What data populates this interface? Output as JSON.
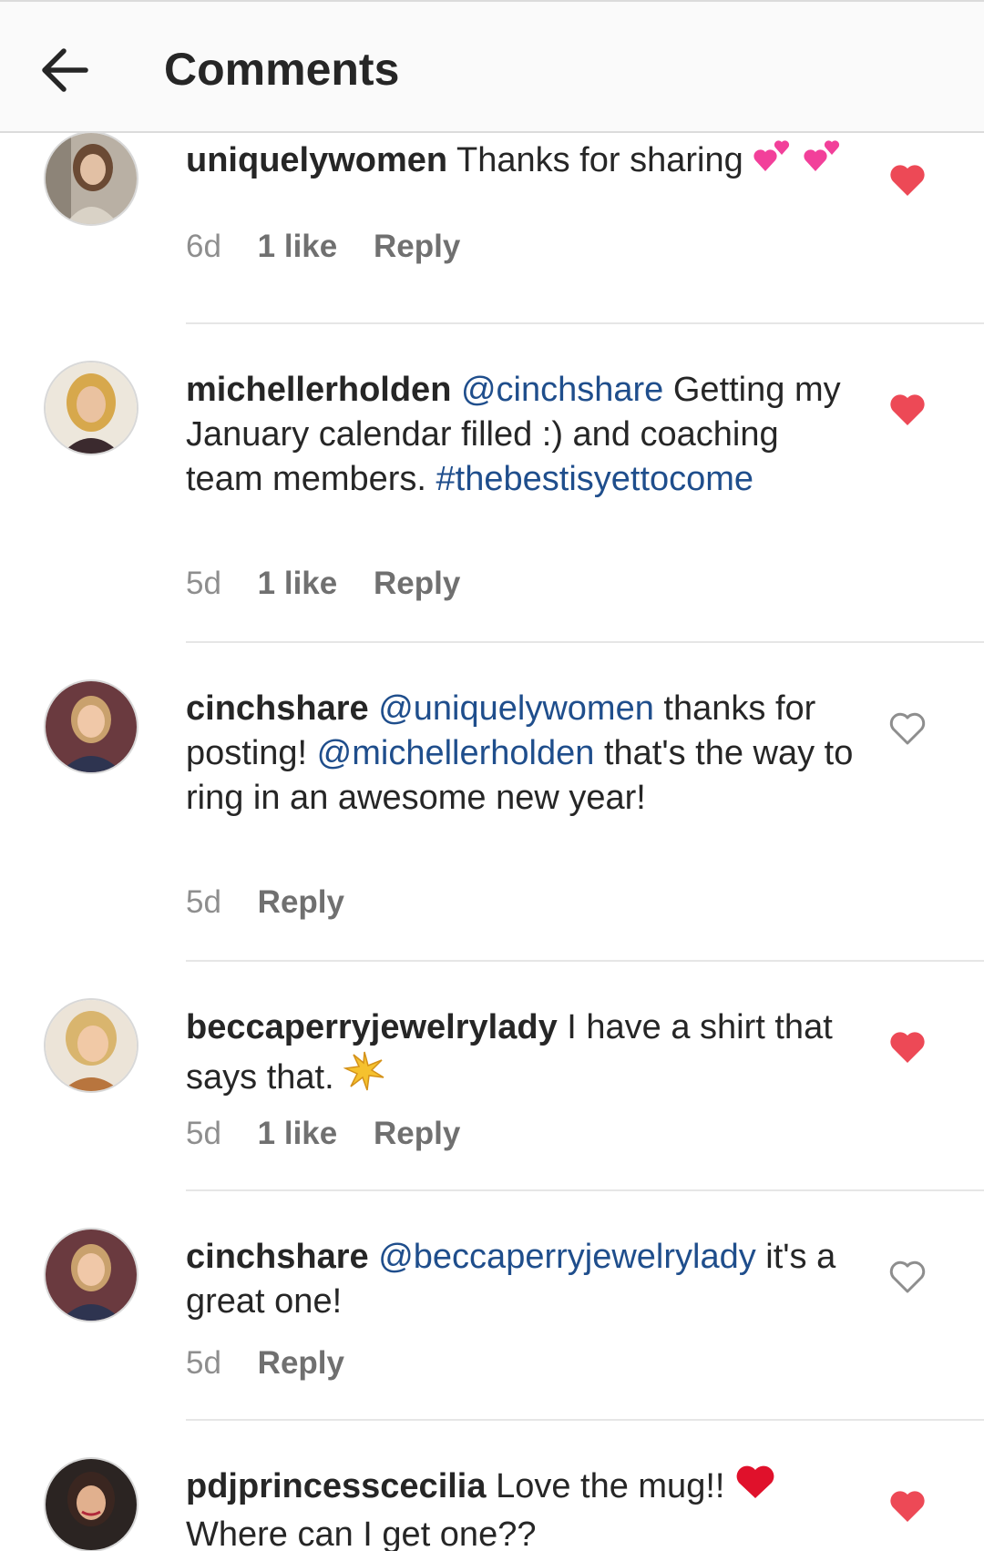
{
  "header": {
    "title": "Comments"
  },
  "comments": [
    {
      "username": "uniquelywomen",
      "text": "Thanks for sharing",
      "time": "6d",
      "likes": "1 like",
      "reply": "Reply",
      "liked": true
    },
    {
      "username": "michellerholden",
      "mention": "@cinchshare",
      "text": "Getting my January calendar filled :) and coaching team members.",
      "hashtag": "#thebestisyettocome",
      "time": "5d",
      "likes": "1 like",
      "reply": "Reply",
      "liked": true
    },
    {
      "username": "cinchshare",
      "mention1": "@uniquelywomen",
      "text1": "thanks for posting!",
      "mention2": "@michellerholden",
      "text2": "that's the way to ring in an awesome new year!",
      "time": "5d",
      "reply": "Reply",
      "liked": false
    },
    {
      "username": "beccaperryjewelrylady",
      "text": "I have a shirt that says that.",
      "time": "5d",
      "likes": "1 like",
      "reply": "Reply",
      "liked": true
    },
    {
      "username": "cinchshare",
      "mention": "@beccaperryjewelrylady",
      "text": "it's a great one!",
      "time": "5d",
      "reply": "Reply",
      "liked": false
    },
    {
      "username": "pdjprincesscecilia",
      "text": "Love the mug!!",
      "text2": "Where can I get one??",
      "liked": true
    }
  ],
  "colors": {
    "heart_liked": "#ed4956",
    "mention": "#1f4e8c",
    "meta": "#8e8e8e"
  }
}
